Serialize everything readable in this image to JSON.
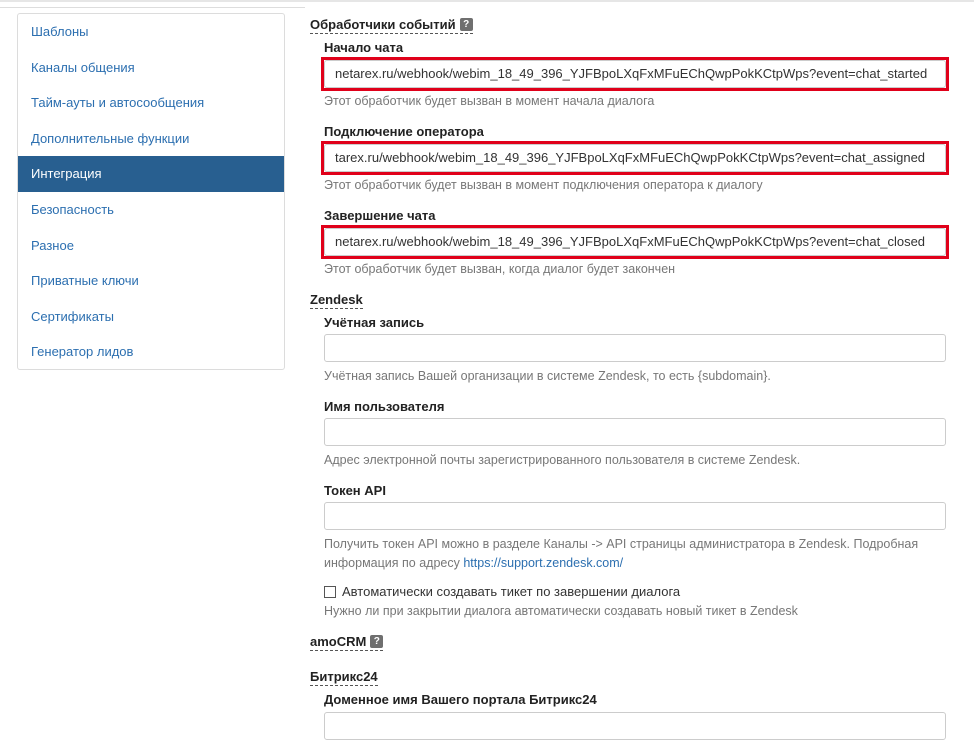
{
  "sidebar": {
    "items": [
      {
        "label": "Шаблоны"
      },
      {
        "label": "Каналы общения"
      },
      {
        "label": "Тайм-ауты и автосообщения"
      },
      {
        "label": "Дополнительные функции"
      },
      {
        "label": "Интеграция",
        "active": true
      },
      {
        "label": "Безопасность"
      },
      {
        "label": "Разное"
      },
      {
        "label": "Приватные ключи"
      },
      {
        "label": "Сертификаты"
      },
      {
        "label": "Генератор лидов"
      }
    ]
  },
  "event_handlers": {
    "title": "Обработчики событий",
    "help_glyph": "?",
    "chat_start": {
      "label": "Начало чата",
      "value": "netarex.ru/webhook/webim_18_49_396_YJFBpoLXqFxMFuEChQwpPokKCtpWps?event=chat_started",
      "hint": "Этот обработчик будет вызван в момент начала диалога"
    },
    "operator_join": {
      "label": "Подключение оператора",
      "value": "tarex.ru/webhook/webim_18_49_396_YJFBpoLXqFxMFuEChQwpPokKCtpWps?event=chat_assigned",
      "hint": "Этот обработчик будет вызван в момент подключения оператора к диалогу"
    },
    "chat_end": {
      "label": "Завершение чата",
      "value": "netarex.ru/webhook/webim_18_49_396_YJFBpoLXqFxMFuEChQwpPokKCtpWps?event=chat_closed",
      "hint": "Этот обработчик будет вызван, когда диалог будет закончен"
    }
  },
  "zendesk": {
    "title": "Zendesk",
    "account": {
      "label": "Учётная запись",
      "value": "",
      "hint": "Учётная запись Вашей организации в системе Zendesk, то есть {subdomain}."
    },
    "username": {
      "label": "Имя пользователя",
      "value": "",
      "hint": "Адрес электронной почты зарегистрированного пользователя в системе Zendesk."
    },
    "token": {
      "label": "Токен API",
      "value": "",
      "hint_line1": "Получить токен API можно в разделе Каналы -> API страницы администратора в Zendesk. Подробная",
      "hint_line2_prefix": "информация по адресу",
      "hint_link": "https://support.zendesk.com/"
    },
    "auto_ticket": {
      "label": "Автоматически создавать тикет по завершении диалога",
      "checked": false,
      "hint": "Нужно ли при закрытии диалога автоматически создавать новый тикет в Zendesk"
    }
  },
  "amocrm": {
    "title": "amoCRM",
    "help_glyph": "?"
  },
  "bitrix24": {
    "title": "Битрикс24",
    "domain": {
      "label": "Доменное имя Вашего портала Битрикс24",
      "value": ""
    }
  },
  "colors": {
    "accent": "#285f90",
    "link": "#2c6fb0",
    "highlight": "#e0001a"
  }
}
